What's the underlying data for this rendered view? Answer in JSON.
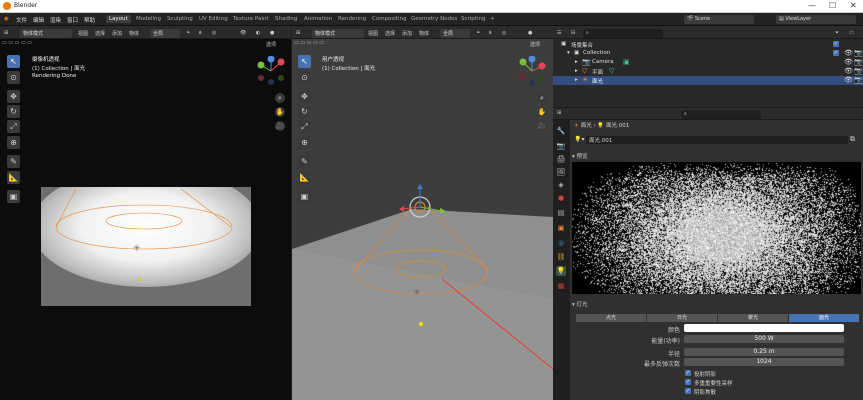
{
  "app": {
    "title": "Blender"
  },
  "window_controls": {
    "minimize": "—",
    "maximize": "☐",
    "close": "✕"
  },
  "menubar": {
    "items": [
      "文件",
      "编辑",
      "渲染",
      "窗口",
      "帮助"
    ],
    "workspaces": [
      "Layout",
      "Modeling",
      "Sculpting",
      "UV Editing",
      "Texture Paint",
      "Shading",
      "Animation",
      "Rendering",
      "Compositing",
      "Geometry Nodes",
      "Scripting",
      "+"
    ],
    "scene": "Scene",
    "view_layer": "ViewLayer"
  },
  "left_viewport": {
    "mode": "物体模式",
    "menus": [
      "视图",
      "选择",
      "添加",
      "物体"
    ],
    "transform": "全局",
    "options": "选项",
    "overlay_lines": [
      "摄像机透视",
      "(1) Collection | 面光",
      "Rendering Done"
    ]
  },
  "right_viewport": {
    "mode": "物体模式",
    "menus": [
      "视图",
      "选择",
      "添加",
      "物体"
    ],
    "transform": "全局",
    "options": "选项",
    "overlay_lines": [
      "用户透视",
      "(1) Collection | 面光"
    ]
  },
  "outliner": {
    "title": "场景集合",
    "rows": [
      {
        "label": "Collection",
        "indent": 1,
        "selected": false
      },
      {
        "label": "Camera",
        "indent": 2,
        "selected": false
      },
      {
        "label": "平面",
        "indent": 2,
        "selected": false
      },
      {
        "label": "面光",
        "indent": 2,
        "selected": true
      }
    ]
  },
  "properties": {
    "breadcrumb": [
      "面光",
      "面光.001"
    ],
    "datablock": "面光.001",
    "preview_label": "预览",
    "light_label": "灯光",
    "light_types": [
      "点光",
      "日光",
      "聚光",
      "面光"
    ],
    "active_type": "面光",
    "fields": [
      {
        "label": "颜色",
        "value": ""
      },
      {
        "label": "能量(功率)",
        "value": "500 W"
      },
      {
        "label": "半径",
        "value": "0.25 m"
      },
      {
        "label": "最多反弹次数",
        "value": "1024"
      }
    ],
    "checkboxes": [
      "投射阴影",
      "多重重要性采样",
      "阴影焦散"
    ]
  },
  "colors": {
    "accent": "#4772b3",
    "selection": "#334d80",
    "orange": "#e87d0d"
  }
}
